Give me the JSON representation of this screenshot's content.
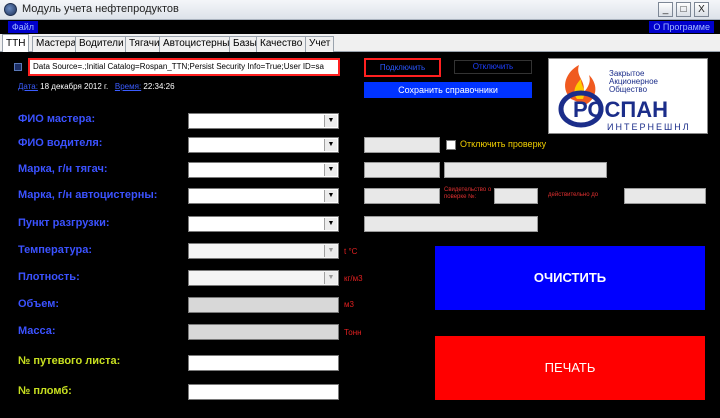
{
  "window": {
    "title": "Модуль учета нефтепродуктов",
    "minimize": "_",
    "maximize": "□",
    "close": "X"
  },
  "menubar": {
    "left": "Файл",
    "right": "О Программе"
  },
  "tabs": [
    "ТТН",
    "Мастера",
    "Водители",
    "Тягачи",
    "Автоцистерны",
    "Базы",
    "Качество",
    "Учет"
  ],
  "connection": {
    "value": "Data Source=.;Initial Catalog=Rospan_TTN;Persist Security Info=True;User ID=sa",
    "connect_label": "Подключить",
    "disconnect_label": "Отключить",
    "save_dictionaries_label": "Сохранить справочники"
  },
  "datetime": {
    "date_label": "Дата:",
    "date_value": "18 декабря 2012 г.",
    "time_label": "Время:",
    "time_value": "22:34:26"
  },
  "form": {
    "master": "ФИО мастера:",
    "driver": "ФИО водителя:",
    "tractor": "Марка, г/н тягач:",
    "tanker": "Марка, г/н автоцистерны:",
    "unloading": "Пункт   разгрузки:",
    "temperature": "Температура:",
    "density": "Плотность:",
    "volume": "Объем:",
    "mass": "Масса:",
    "waybill": "№ путевого листа:",
    "seals": "№ пломб:"
  },
  "units": {
    "temperature": "t °C",
    "density": "кг/м3",
    "volume": "м3",
    "mass": "Тонн"
  },
  "extra": {
    "disable_check_label": "Отключить проверку",
    "certificate_label": "Свидетельство о поверке №:",
    "valid_until_label": "действительно до"
  },
  "buttons": {
    "clear": "ОЧИСТИТЬ",
    "print": "ПЕЧАТЬ"
  },
  "logo": {
    "company_lines": [
      "Закрытое",
      "Акционерное",
      "Общество"
    ],
    "name": "РОСПАН",
    "subtitle": "ИНТЕРНЕШНЛ"
  },
  "colors": {
    "background": "#000000",
    "label_blue": "#3b52ff",
    "label_green": "#c8e020",
    "clear_button": "#0000ff",
    "print_button": "#ff0000",
    "highlight_border": "#ff2020"
  }
}
